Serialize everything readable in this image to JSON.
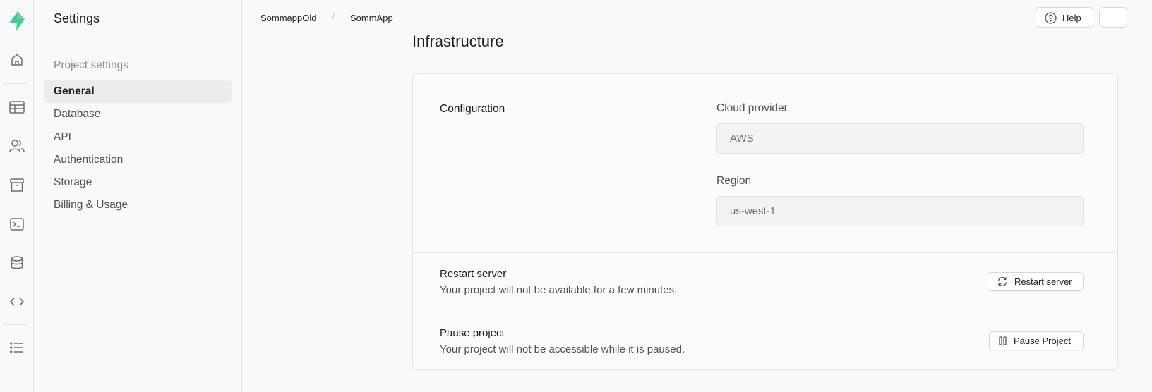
{
  "colors": {
    "brand": "#3ecf8e",
    "accent_dark": "#249361"
  },
  "rail": {
    "icons": [
      "supabase-logo-icon",
      "home-icon",
      "table-editor-icon",
      "users-icon",
      "storage-archive-icon",
      "terminal-icon",
      "database-icon",
      "code-icon",
      "list-icon"
    ]
  },
  "menu": {
    "title": "Settings",
    "section_label": "Project settings",
    "items": [
      {
        "label": "General"
      },
      {
        "label": "Database"
      },
      {
        "label": "API"
      },
      {
        "label": "Authentication"
      },
      {
        "label": "Storage"
      },
      {
        "label": "Billing & Usage"
      }
    ]
  },
  "topbar": {
    "breadcrumb": [
      "SommappOld",
      "SommApp"
    ],
    "breadcrumb_separator": "/",
    "help_label": "Help"
  },
  "main": {
    "title": "Infrastructure",
    "configuration": {
      "label": "Configuration",
      "cloud_provider_label": "Cloud provider",
      "cloud_provider_value": "AWS",
      "region_label": "Region",
      "region_value": "us-west-1"
    },
    "restart": {
      "title": "Restart server",
      "description": "Your project will not be available for a few minutes.",
      "button_label": "Restart server"
    },
    "pause": {
      "title": "Pause project",
      "description": "Your project will not be accessible while it is paused.",
      "button_label": "Pause Project"
    }
  }
}
